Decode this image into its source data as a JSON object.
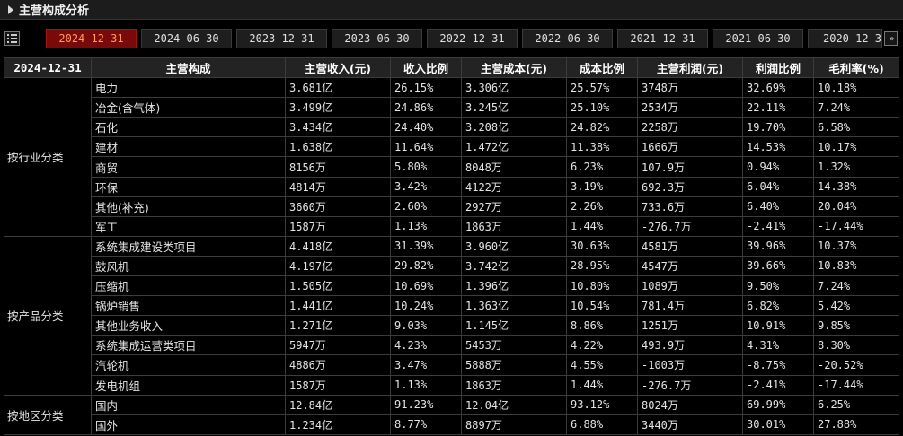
{
  "window": {
    "title": "主营构成分析"
  },
  "tabs": [
    {
      "label": "2024-12-31",
      "active": true
    },
    {
      "label": "2024-06-30",
      "active": false
    },
    {
      "label": "2023-12-31",
      "active": false
    },
    {
      "label": "2023-06-30",
      "active": false
    },
    {
      "label": "2022-12-31",
      "active": false
    },
    {
      "label": "2022-06-30",
      "active": false
    },
    {
      "label": "2021-12-31",
      "active": false
    },
    {
      "label": "2021-06-30",
      "active": false
    },
    {
      "label": "2020-12-3",
      "active": false
    }
  ],
  "more_glyph": "»",
  "table": {
    "headers": [
      "2024-12-31",
      "主营构成",
      "主营收入(元)",
      "收入比例",
      "主营成本(元)",
      "成本比例",
      "主营利润(元)",
      "利润比例",
      "毛利率(%)"
    ],
    "groups": [
      {
        "label": "按行业分类",
        "rows": [
          [
            "电力",
            "3.681亿",
            "26.15%",
            "3.306亿",
            "25.57%",
            "3748万",
            "32.69%",
            "10.18%"
          ],
          [
            "冶金(含气体)",
            "3.499亿",
            "24.86%",
            "3.245亿",
            "25.10%",
            "2534万",
            "22.11%",
            "7.24%"
          ],
          [
            "石化",
            "3.434亿",
            "24.40%",
            "3.208亿",
            "24.82%",
            "2258万",
            "19.70%",
            "6.58%"
          ],
          [
            "建材",
            "1.638亿",
            "11.64%",
            "1.472亿",
            "11.38%",
            "1666万",
            "14.53%",
            "10.17%"
          ],
          [
            "商贸",
            "8156万",
            "5.80%",
            "8048万",
            "6.23%",
            "107.9万",
            "0.94%",
            "1.32%"
          ],
          [
            "环保",
            "4814万",
            "3.42%",
            "4122万",
            "3.19%",
            "692.3万",
            "6.04%",
            "14.38%"
          ],
          [
            "其他(补充)",
            "3660万",
            "2.60%",
            "2927万",
            "2.26%",
            "733.6万",
            "6.40%",
            "20.04%"
          ],
          [
            "军工",
            "1587万",
            "1.13%",
            "1863万",
            "1.44%",
            "-276.7万",
            "-2.41%",
            "-17.44%"
          ]
        ]
      },
      {
        "label": "按产品分类",
        "rows": [
          [
            "系统集成建设类项目",
            "4.418亿",
            "31.39%",
            "3.960亿",
            "30.63%",
            "4581万",
            "39.96%",
            "10.37%"
          ],
          [
            "鼓风机",
            "4.197亿",
            "29.82%",
            "3.742亿",
            "28.95%",
            "4547万",
            "39.66%",
            "10.83%"
          ],
          [
            "压缩机",
            "1.505亿",
            "10.69%",
            "1.396亿",
            "10.80%",
            "1089万",
            "9.50%",
            "7.24%"
          ],
          [
            "锅炉销售",
            "1.441亿",
            "10.24%",
            "1.363亿",
            "10.54%",
            "781.4万",
            "6.82%",
            "5.42%"
          ],
          [
            "其他业务收入",
            "1.271亿",
            "9.03%",
            "1.145亿",
            "8.86%",
            "1251万",
            "10.91%",
            "9.85%"
          ],
          [
            "系统集成运营类项目",
            "5947万",
            "4.23%",
            "5453万",
            "4.22%",
            "493.9万",
            "4.31%",
            "8.30%"
          ],
          [
            "汽轮机",
            "4886万",
            "3.47%",
            "5888万",
            "4.55%",
            "-1003万",
            "-8.75%",
            "-20.52%"
          ],
          [
            "发电机组",
            "1587万",
            "1.13%",
            "1863万",
            "1.44%",
            "-276.7万",
            "-2.41%",
            "-17.44%"
          ]
        ]
      },
      {
        "label": "按地区分类",
        "rows": [
          [
            "国内",
            "12.84亿",
            "91.23%",
            "12.04亿",
            "93.12%",
            "8024万",
            "69.99%",
            "6.25%"
          ],
          [
            "国外",
            "1.234亿",
            "8.77%",
            "8897万",
            "6.88%",
            "3440万",
            "30.01%",
            "27.88%"
          ]
        ]
      }
    ]
  },
  "colors": {
    "background": "#000000",
    "active_tab_bg": "#7a0a0a",
    "active_tab_text": "#ff9b5a",
    "grid": "#3c3c3c"
  }
}
